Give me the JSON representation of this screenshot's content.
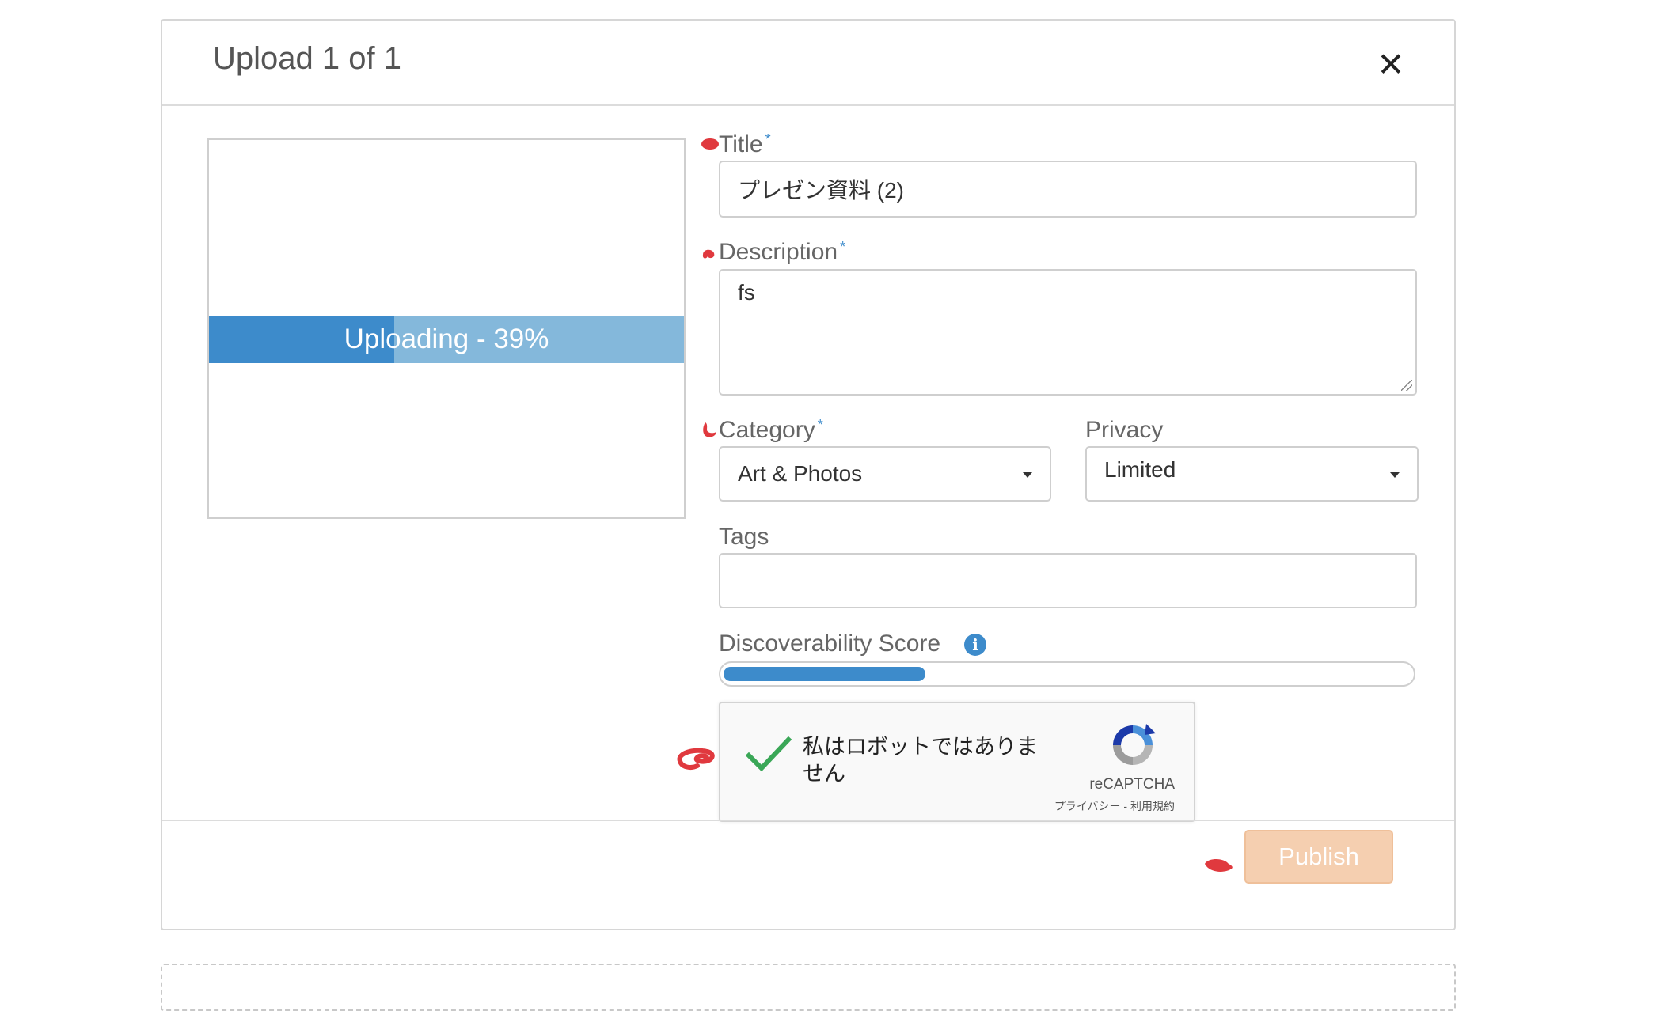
{
  "modal": {
    "title": "Upload 1 of 1",
    "close_icon": "close-icon"
  },
  "preview": {
    "progress_label": "Uploading - 39%",
    "progress_fraction": 0.39
  },
  "form": {
    "title_label": "Title",
    "title_value": "プレゼン資料 (2)",
    "description_label": "Description",
    "description_value": "fs",
    "category_label": "Category",
    "category_value": "Art & Photos",
    "privacy_label": "Privacy",
    "privacy_value": "Limited",
    "tags_label": "Tags",
    "tags_value": "",
    "required_marker": "*",
    "discoverability_label": "Discoverability Score",
    "discoverability_fraction": 0.3,
    "info_icon": "info-icon"
  },
  "recaptcha": {
    "checkbox_text": "私はロボットではありません",
    "brand": "reCAPTCHA",
    "links": "プライバシー - 利用規約",
    "checked": true
  },
  "footer": {
    "publish_label": "Publish"
  },
  "colors": {
    "accent": "#3d8bcb",
    "progress_track": "#84b8db",
    "publish_disabled": "#f5cfb0",
    "annotation_red": "#e0393e",
    "check_green": "#3aa757"
  }
}
